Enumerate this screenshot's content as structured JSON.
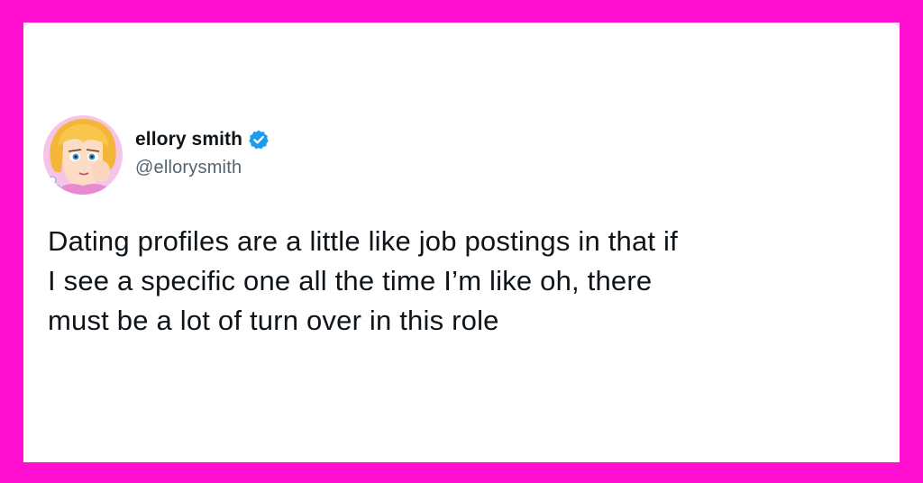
{
  "colors": {
    "frame_border": "#ff10d0",
    "card_background": "#ffffff",
    "name_text": "#0f1419",
    "handle_text": "#536471",
    "verified_badge": "#1d9bf0"
  },
  "tweet": {
    "author": {
      "display_name": "ellory smith",
      "handle": "@ellorysmith",
      "verified": true,
      "verified_icon": "verified-badge-icon",
      "avatar": "cartoon-avatar"
    },
    "text_lines": [
      "Dating profiles are a little like job postings in that if",
      "I see a specific one all the time I’m like oh, there",
      "must be a lot of turn over in this role"
    ]
  }
}
